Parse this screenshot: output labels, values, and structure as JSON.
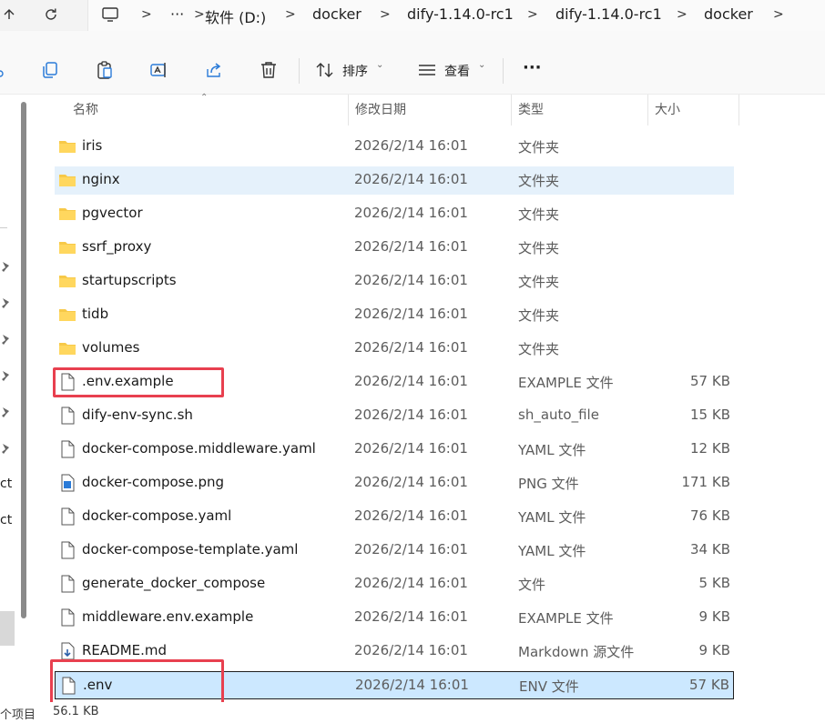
{
  "breadcrumb": {
    "items": [
      "软件 (D:)",
      "docker",
      "dify-1.14.0-rc1",
      "dify-1.14.0-rc1",
      "docker"
    ],
    "overflow": "···"
  },
  "toolbar": {
    "sort_label": "排序",
    "view_label": "查看",
    "more_label": "···"
  },
  "columns": {
    "name": "名称",
    "date": "修改日期",
    "type": "类型",
    "size": "大小"
  },
  "files": [
    {
      "name": "iris",
      "date": "2026/2/14 16:01",
      "type": "文件夹",
      "size": "",
      "icon": "folder-icon"
    },
    {
      "name": "nginx",
      "date": "2026/2/14 16:01",
      "type": "文件夹",
      "size": "",
      "icon": "folder-icon"
    },
    {
      "name": "pgvector",
      "date": "2026/2/14 16:01",
      "type": "文件夹",
      "size": "",
      "icon": "folder-icon"
    },
    {
      "name": "ssrf_proxy",
      "date": "2026/2/14 16:01",
      "type": "文件夹",
      "size": "",
      "icon": "folder-icon"
    },
    {
      "name": "startupscripts",
      "date": "2026/2/14 16:01",
      "type": "文件夹",
      "size": "",
      "icon": "folder-icon"
    },
    {
      "name": "tidb",
      "date": "2026/2/14 16:01",
      "type": "文件夹",
      "size": "",
      "icon": "folder-icon"
    },
    {
      "name": "volumes",
      "date": "2026/2/14 16:01",
      "type": "文件夹",
      "size": "",
      "icon": "folder-icon"
    },
    {
      "name": ".env.example",
      "date": "2026/2/14 16:01",
      "type": "EXAMPLE 文件",
      "size": "57 KB",
      "icon": "file-icon"
    },
    {
      "name": "dify-env-sync.sh",
      "date": "2026/2/14 16:01",
      "type": "sh_auto_file",
      "size": "15 KB",
      "icon": "file-icon"
    },
    {
      "name": "docker-compose.middleware.yaml",
      "date": "2026/2/14 16:01",
      "type": "YAML 文件",
      "size": "12 KB",
      "icon": "file-icon"
    },
    {
      "name": "docker-compose.png",
      "date": "2026/2/14 16:01",
      "type": "PNG 文件",
      "size": "171 KB",
      "icon": "image-file-icon"
    },
    {
      "name": "docker-compose.yaml",
      "date": "2026/2/14 16:01",
      "type": "YAML 文件",
      "size": "76 KB",
      "icon": "file-icon"
    },
    {
      "name": "docker-compose-template.yaml",
      "date": "2026/2/14 16:01",
      "type": "YAML 文件",
      "size": "34 KB",
      "icon": "file-icon"
    },
    {
      "name": "generate_docker_compose",
      "date": "2026/2/14 16:01",
      "type": "文件",
      "size": "5 KB",
      "icon": "file-icon"
    },
    {
      "name": "middleware.env.example",
      "date": "2026/2/14 16:01",
      "type": "EXAMPLE 文件",
      "size": "9 KB",
      "icon": "file-icon"
    },
    {
      "name": "README.md",
      "date": "2026/2/14 16:01",
      "type": "Markdown 源文件",
      "size": "9 KB",
      "icon": "markdown-file-icon"
    },
    {
      "name": ".env",
      "date": "2026/2/14 16:01",
      "type": "ENV 文件",
      "size": "57 KB",
      "icon": "file-icon"
    }
  ],
  "left_pane": {
    "partial_labels": [
      "ct",
      "ct"
    ]
  },
  "status_bar": {
    "items_text": "个项目",
    "size_text": "56.1 KB"
  },
  "colors": {
    "folder": "#f7c948",
    "hover_row": "#e5f1fb",
    "selected_row": "#cce8ff",
    "highlight_box": "#e8404f"
  }
}
